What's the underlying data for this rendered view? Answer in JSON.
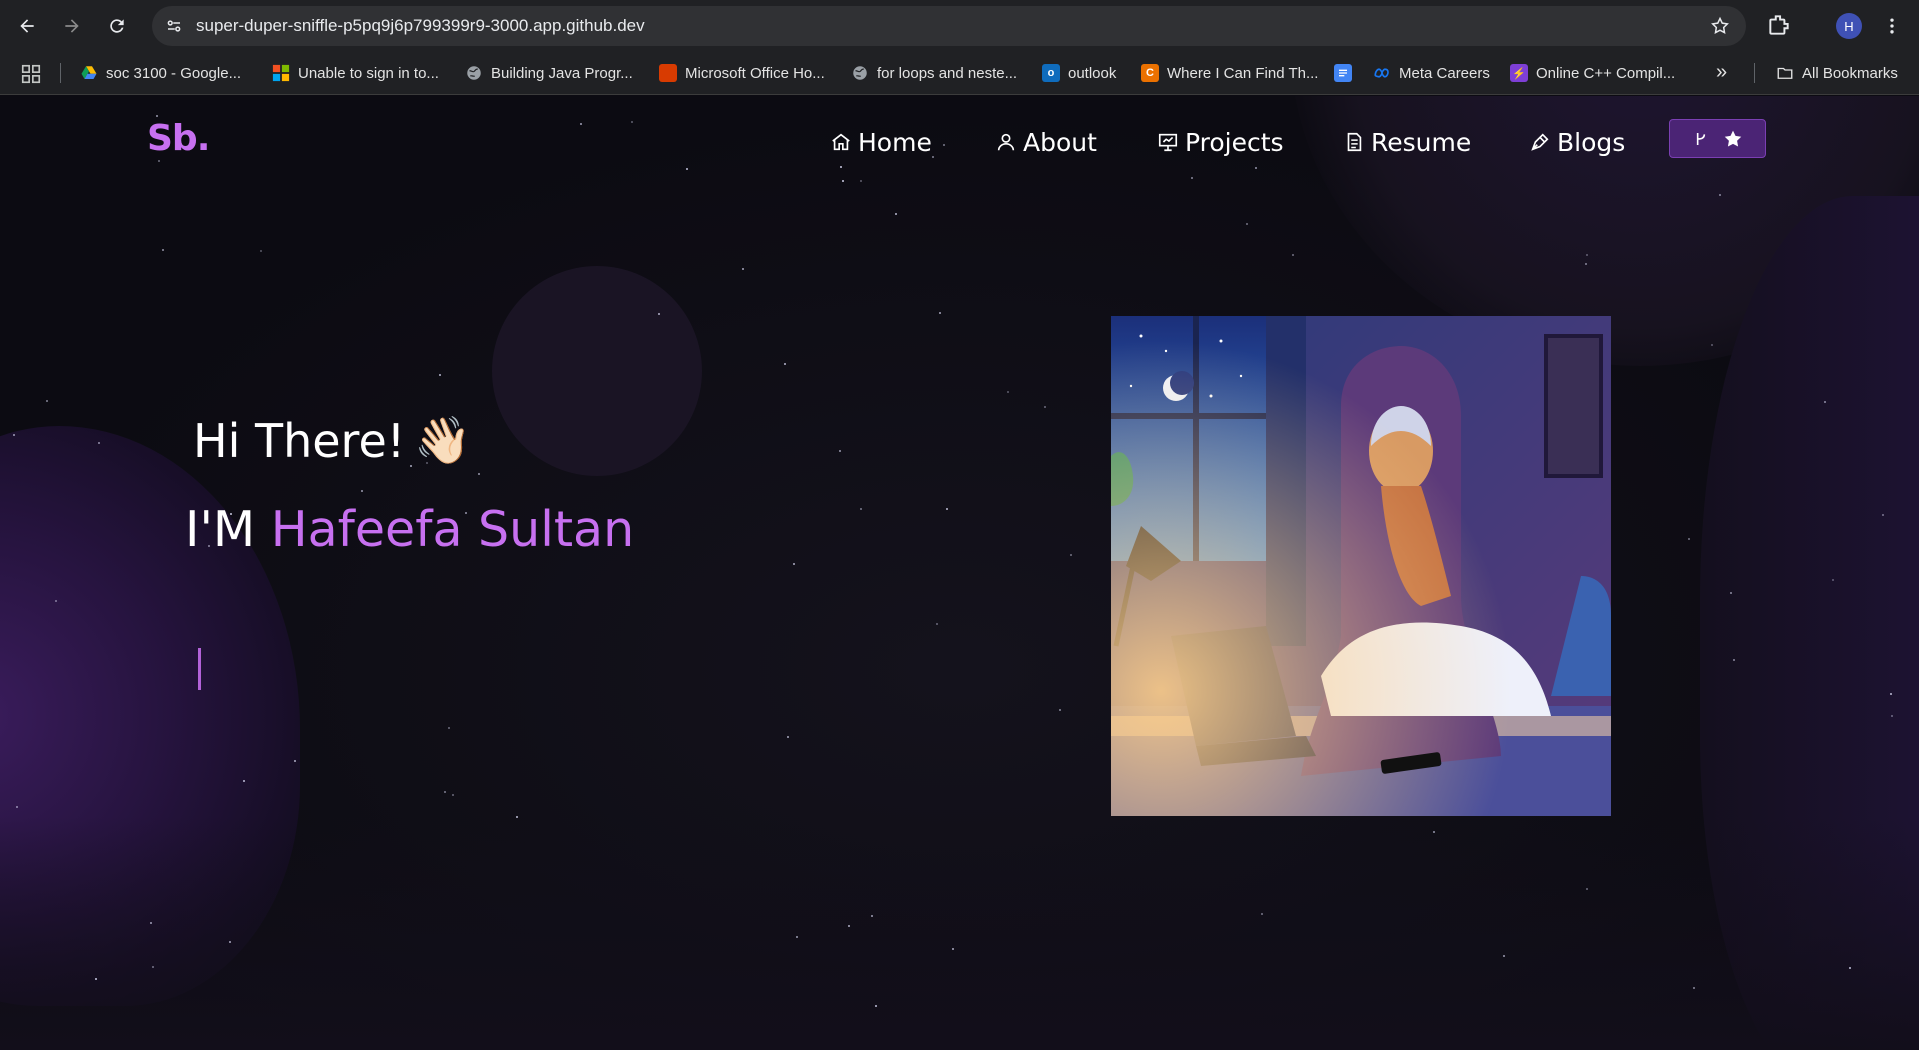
{
  "browser": {
    "url": "super-duper-sniffle-p5pq9j6p799399r9-3000.app.github.dev",
    "profile_initial": "H",
    "bookmarks": [
      {
        "label": "soc 3100 - Google...",
        "icon": "google-drive-icon"
      },
      {
        "label": "Unable to sign in to...",
        "icon": "microsoft-icon"
      },
      {
        "label": "Building Java Progr...",
        "icon": "globe-icon"
      },
      {
        "label": "Microsoft Office Ho...",
        "icon": "office-icon"
      },
      {
        "label": "for loops and neste...",
        "icon": "globe-icon"
      },
      {
        "label": "outlook",
        "icon": "outlook-icon"
      },
      {
        "label": "Where I Can Find Th...",
        "icon": "chegg-icon"
      },
      {
        "label": "Meta Careers",
        "icon": "meta-icon"
      },
      {
        "label": "Online C++ Compil...",
        "icon": "bolt-icon"
      }
    ],
    "more_label": "»",
    "all_bookmarks": "All Bookmarks"
  },
  "site": {
    "logo": "Sb.",
    "nav": {
      "home": "Home",
      "about": "About",
      "projects": "Projects",
      "resume": "Resume",
      "blogs": "Blogs"
    },
    "hero": {
      "greeting": "Hi There!",
      "wave_emoji": "👋🏻",
      "intro_prefix": "I'M",
      "name": "Hafeefa Sultan"
    }
  },
  "colors": {
    "accent": "#c770f0",
    "page_bg": "#0c0b12",
    "fork_button": "#4b2475"
  }
}
